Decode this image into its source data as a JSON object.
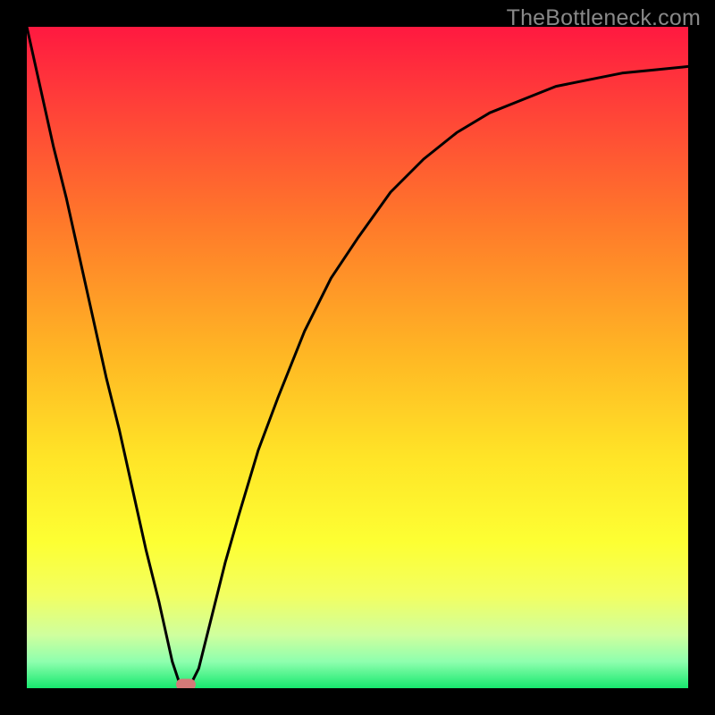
{
  "watermark": "TheBottleneck.com",
  "chart_data": {
    "type": "line",
    "title": "",
    "xlabel": "",
    "ylabel": "",
    "xlim": [
      0,
      100
    ],
    "ylim": [
      0,
      100
    ],
    "x": [
      0,
      2,
      4,
      6,
      8,
      10,
      12,
      14,
      16,
      18,
      20,
      22,
      23,
      24,
      25,
      26,
      28,
      30,
      32,
      35,
      38,
      42,
      46,
      50,
      55,
      60,
      65,
      70,
      75,
      80,
      85,
      90,
      95,
      100
    ],
    "values": [
      100,
      91,
      82,
      74,
      65,
      56,
      47,
      39,
      30,
      21,
      13,
      4,
      1,
      0,
      1,
      3,
      11,
      19,
      26,
      36,
      44,
      54,
      62,
      68,
      75,
      80,
      84,
      87,
      89,
      91,
      92,
      93,
      93.5,
      94
    ],
    "marker": {
      "x": 24,
      "y": 0,
      "color": "#d47a78"
    },
    "gradient_stops": [
      {
        "offset": 0.0,
        "color": "#ff1940"
      },
      {
        "offset": 0.1,
        "color": "#ff3a3a"
      },
      {
        "offset": 0.3,
        "color": "#ff7a2a"
      },
      {
        "offset": 0.5,
        "color": "#ffb824"
      },
      {
        "offset": 0.65,
        "color": "#ffe427"
      },
      {
        "offset": 0.78,
        "color": "#fdff33"
      },
      {
        "offset": 0.86,
        "color": "#f2ff62"
      },
      {
        "offset": 0.92,
        "color": "#cfff9e"
      },
      {
        "offset": 0.96,
        "color": "#8effae"
      },
      {
        "offset": 1.0,
        "color": "#17e86e"
      }
    ]
  }
}
